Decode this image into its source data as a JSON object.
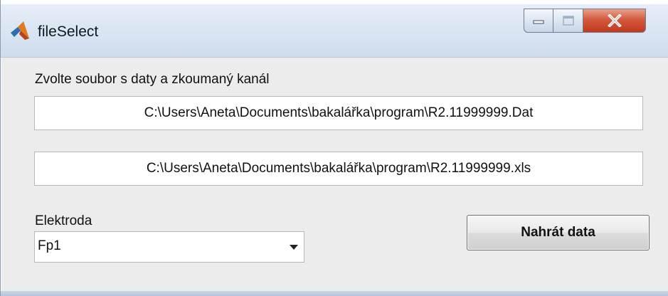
{
  "window": {
    "title": "fileSelect",
    "app_icon": "matlab-logo-icon",
    "controls": {
      "minimize_icon": "minimize-icon",
      "maximize_icon": "maximize-icon",
      "close_icon": "close-icon"
    },
    "close_color": "#c7401f"
  },
  "form": {
    "instruction_label": "Zvolte soubor s daty a zkoumaný kanál",
    "data_file_path": "C:\\Users\\Aneta\\Documents\\bakalářka\\program\\R2.11999999.Dat",
    "xls_file_path": "C:\\Users\\Aneta\\Documents\\bakalářka\\program\\R2.11999999.xls",
    "electrode_label": "Elektroda",
    "electrode_selected": "Fp1",
    "load_button_label": "Nahrát data"
  }
}
